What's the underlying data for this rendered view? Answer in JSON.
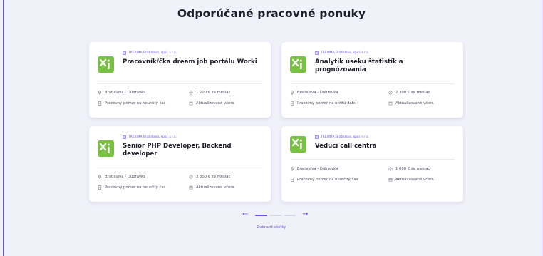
{
  "section": {
    "title": "Odporúčané pracovné ponuky"
  },
  "colors": {
    "accent": "#6b54e8",
    "logo": "#79c142",
    "background": "#f1f1fa"
  },
  "jobs": [
    {
      "company": "TREXIMA Bratislava, spol. s r.o.",
      "title": "Pracovník/čka dream job portálu Worki",
      "location": "Bratislava - Dúbravka",
      "salary": "1 200 € za mesiac",
      "contract": "Pracovný pomer na neurčitý čas",
      "updated": "Aktualizované včera"
    },
    {
      "company": "TREXIMA Bratislava, spol. s r.o.",
      "title": "Analytik úseku štatistík a prognózovania",
      "location": "Bratislava - Dúbravka",
      "salary": "2 300 € za mesiac",
      "contract": "Pracovný pomer na určitú dobu",
      "updated": "Aktualizované včera"
    },
    {
      "company": "TREXIMA Bratislava, spol. s r.o.",
      "title": "Senior PHP Developer, Backend developer",
      "location": "Bratislava - Dúbravka",
      "salary": "3 300 € za mesiac",
      "contract": "Pracovný pomer na neurčitý čas",
      "updated": "Aktualizované včera"
    },
    {
      "company": "TREXIMA Bratislava, spol. s r.o.",
      "title": "Vedúci call centra",
      "location": "Bratislava - Dúbravka",
      "salary": "1 600 € za mesiac",
      "contract": "Pracovný pomer na neurčitý čas",
      "updated": "Aktualizované včera"
    }
  ],
  "pagination": {
    "prev_icon": "arrow-left-icon",
    "next_icon": "arrow-right-icon",
    "total_pages": 3,
    "active_page": 1
  },
  "show_all_label": "Zobraziť všetky"
}
